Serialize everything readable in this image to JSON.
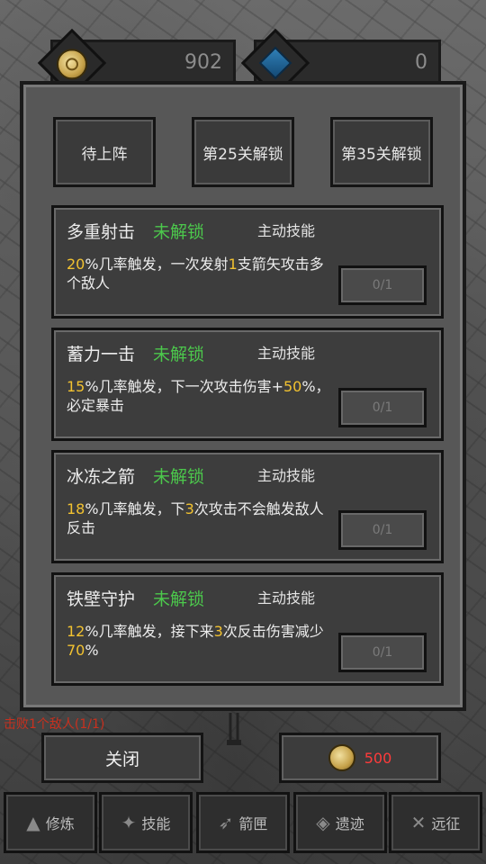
{
  "currency": {
    "gold": {
      "icon": "coin-icon",
      "amount": "902"
    },
    "gems": {
      "icon": "gem-icon",
      "amount": "0"
    }
  },
  "tabs": [
    {
      "label": "待上阵"
    },
    {
      "label": "第25关解锁"
    },
    {
      "label": "第35关解锁"
    }
  ],
  "skills": [
    {
      "name": "多重射击",
      "status": "未解锁",
      "type": "主动技能",
      "desc": [
        {
          "t": "20",
          "hl": true
        },
        {
          "t": "%几率触发，一次发射",
          "hl": false
        },
        {
          "t": "1",
          "hl": true
        },
        {
          "t": "支箭矢攻击多个敌人",
          "hl": false
        }
      ],
      "progress": "0/1"
    },
    {
      "name": "蓄力一击",
      "status": "未解锁",
      "type": "主动技能",
      "desc": [
        {
          "t": "15",
          "hl": true
        },
        {
          "t": "%几率触发，下一次攻击伤害+",
          "hl": false
        },
        {
          "t": "50",
          "hl": true
        },
        {
          "t": "%，必定暴击",
          "hl": false
        }
      ],
      "progress": "0/1"
    },
    {
      "name": "冰冻之箭",
      "status": "未解锁",
      "type": "主动技能",
      "desc": [
        {
          "t": "18",
          "hl": true
        },
        {
          "t": "%几率触发，下",
          "hl": false
        },
        {
          "t": "3",
          "hl": true
        },
        {
          "t": "次攻击不会触发敌人反击",
          "hl": false
        }
      ],
      "progress": "0/1"
    },
    {
      "name": "铁壁守护",
      "status": "未解锁",
      "type": "主动技能",
      "desc": [
        {
          "t": "12",
          "hl": true
        },
        {
          "t": "%几率触发，接下来",
          "hl": false
        },
        {
          "t": "3",
          "hl": true
        },
        {
          "t": "次反击伤害减少",
          "hl": false
        },
        {
          "t": "70",
          "hl": true
        },
        {
          "t": "%",
          "hl": false
        }
      ],
      "progress": "0/1"
    }
  ],
  "quest": {
    "text": "击败1个敌人(1/1)"
  },
  "actions": {
    "close_label": "关闭",
    "price_icon": "coin-icon",
    "price": "500"
  },
  "nav": [
    {
      "label": "修炼",
      "icon": "campfire-icon"
    },
    {
      "label": "技能",
      "icon": "skill-icon"
    },
    {
      "label": "箭匣",
      "icon": "quiver-icon"
    },
    {
      "label": "遗迹",
      "icon": "ruins-icon"
    },
    {
      "label": "远征",
      "icon": "expedition-icon"
    }
  ],
  "colors": {
    "locked": "#4cc84c",
    "highlight": "#f2c230",
    "price": "#ff3b3b",
    "quest": "#c8301e"
  }
}
